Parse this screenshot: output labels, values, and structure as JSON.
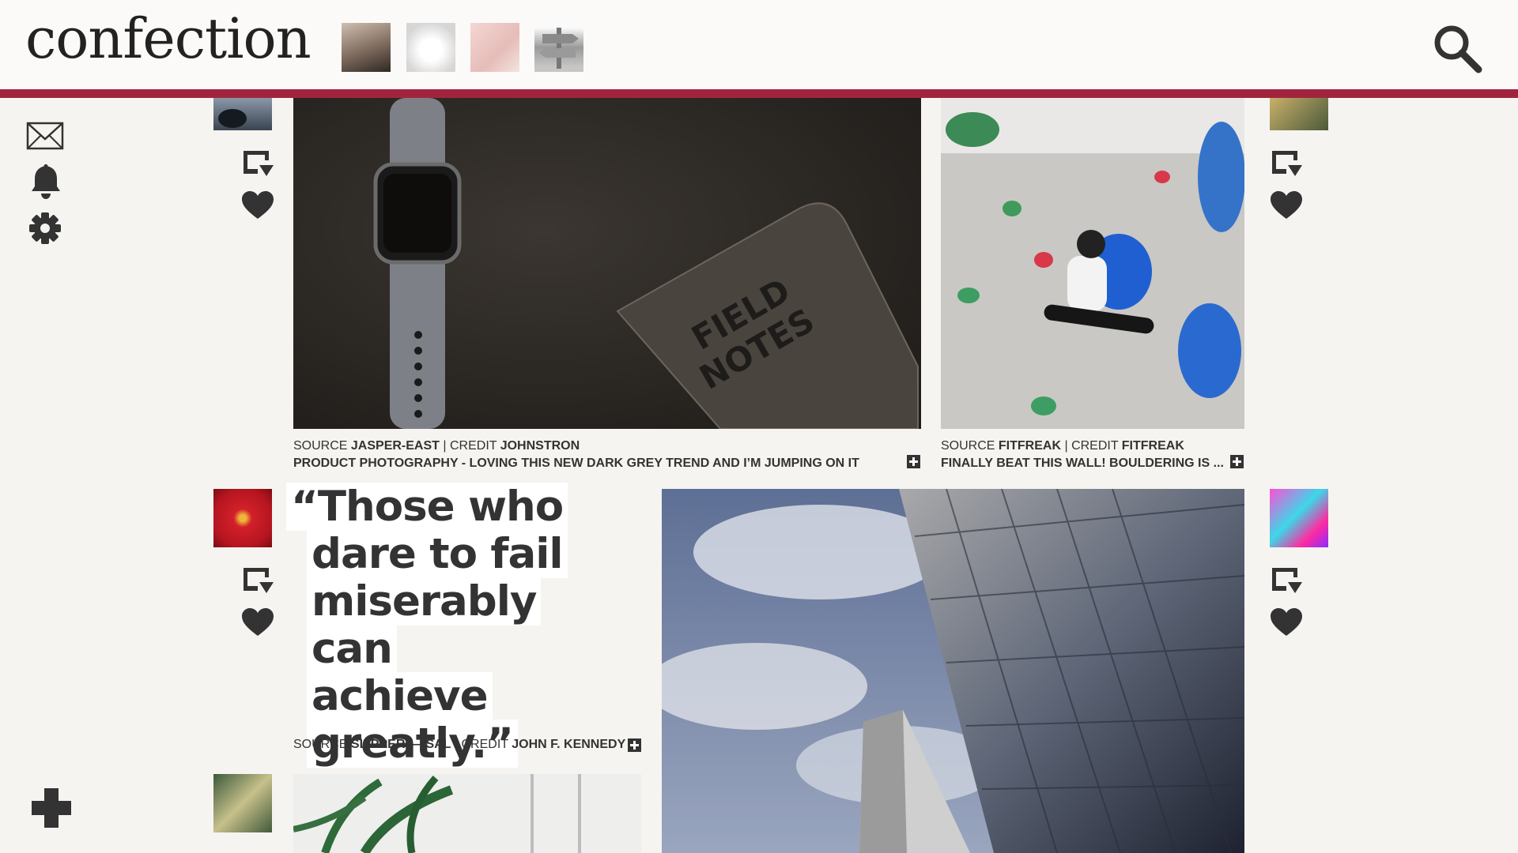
{
  "app": {
    "logo": "confection"
  },
  "header": {
    "recent_thumbnails": [
      "woman-portrait",
      "white-dog",
      "pink-camera",
      "signpost"
    ],
    "search_icon": "search-icon"
  },
  "rail": {
    "icons": [
      "mail-icon",
      "bell-icon",
      "gear-icon"
    ],
    "add_icon": "plus-icon"
  },
  "posts": [
    {
      "source_label": "SOURCE",
      "source": "JASPER-EAST",
      "credit_label": "CREDIT",
      "credit": "JOHNSTRON",
      "caption": "PRODUCT PHOTOGRAPHY - LOVING THIS NEW DARK GREY TREND AND I’M JUMPING ON IT"
    },
    {
      "source_label": "SOURCE",
      "source": "FITFREAK",
      "credit_label": "CREDIT",
      "credit": "FITFREAK",
      "caption": "FINALLY BEAT THIS WALL! BOULDERING IS ..."
    },
    {
      "quote_lines": [
        "“Those who",
        "dare to fail",
        "miserably can",
        "achieve",
        "greatly.”"
      ],
      "source_label": "SOURCE",
      "source": "SLIPPERY—SAL",
      "credit_label": "CREDIT",
      "credit": "JOHN F. KENNEDY"
    }
  ],
  "colors": {
    "accent": "#a1243d",
    "background": "#f6f4f0",
    "icon": "#333333"
  }
}
